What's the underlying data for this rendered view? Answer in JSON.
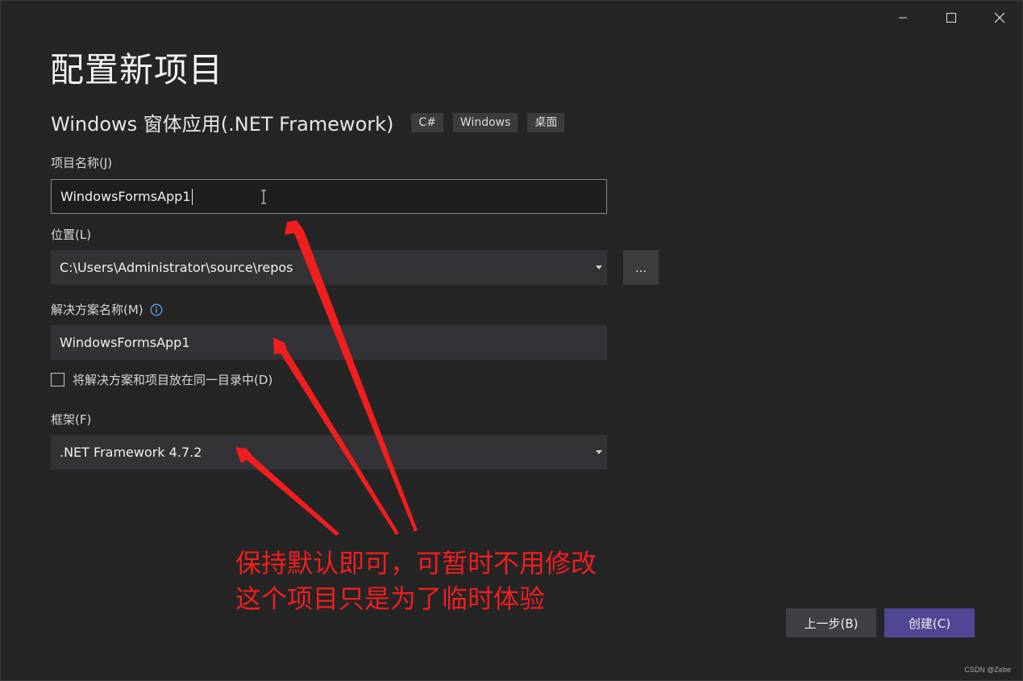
{
  "window": {
    "controls": {
      "minimize_icon": "minimize-icon",
      "maximize_icon": "maximize-icon",
      "close_icon": "close-icon"
    }
  },
  "page": {
    "title": "配置新项目"
  },
  "template": {
    "name": "Windows 窗体应用(.NET Framework)",
    "tags": [
      "C#",
      "Windows",
      "桌面"
    ]
  },
  "form": {
    "project_name": {
      "label": "项目名称(J)",
      "value": "WindowsFormsApp1"
    },
    "location": {
      "label": "位置(L)",
      "value": "C:\\Users\\Administrator\\source\\repos",
      "browse_label": "..."
    },
    "solution_name": {
      "label": "解决方案名称(M)",
      "value": "WindowsFormsApp1",
      "info_icon": "info-icon"
    },
    "same_directory": {
      "label": "将解决方案和项目放在同一目录中(D)",
      "checked": false
    },
    "framework": {
      "label": "框架(F)",
      "value": ".NET Framework 4.7.2"
    }
  },
  "actions": {
    "back_label": "上一步(B)",
    "create_label": "创建(C)"
  },
  "annotation": {
    "line1": "保持默认即可，可暂时不用修改",
    "line2": "这个项目只是为了临时体验",
    "color": "#f01e1e"
  },
  "watermark": "CSDN @Zebe",
  "colors": {
    "background": "#252526",
    "input": "#333337",
    "create_button": "#4f4694",
    "back_button": "#3f3f46"
  }
}
